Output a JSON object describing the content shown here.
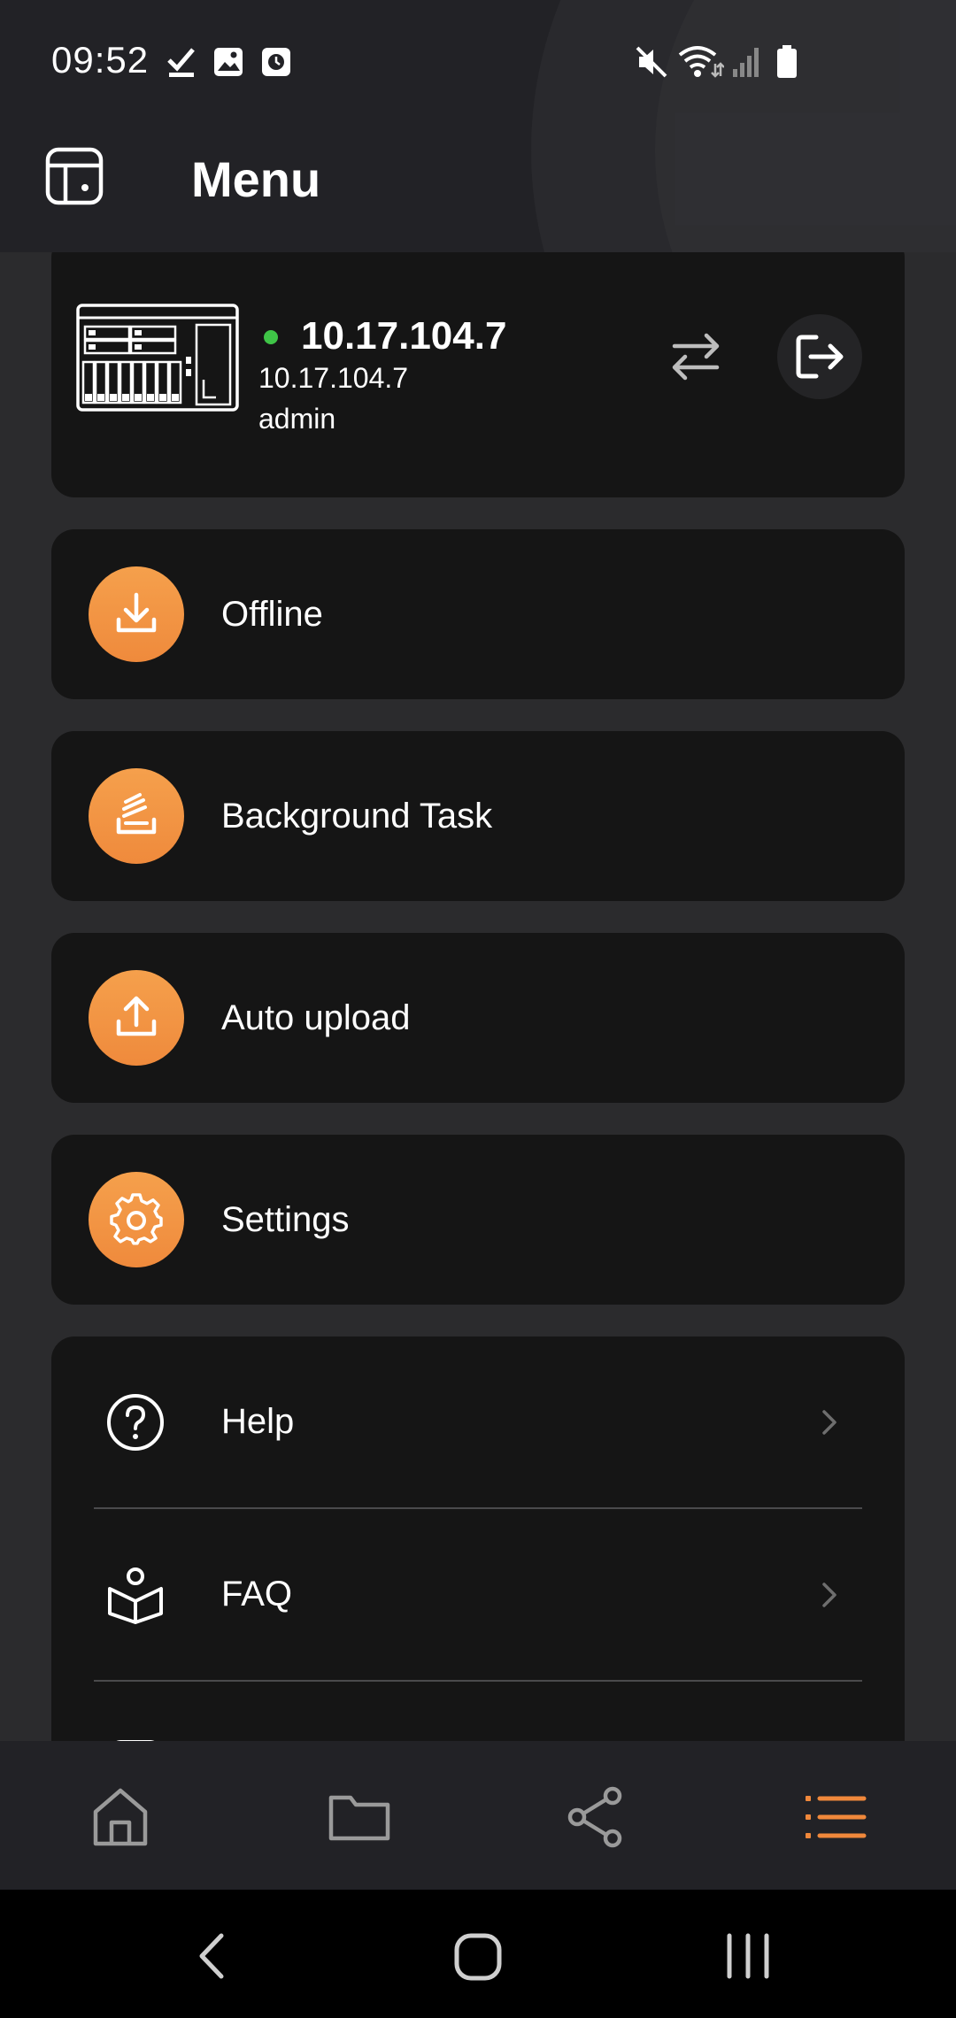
{
  "status_bar": {
    "time": "09:52",
    "left_icons": [
      "check-icon",
      "image-icon",
      "clock-icon"
    ],
    "right_icons": [
      "mute-icon",
      "wifi-icon",
      "signal-icon",
      "battery-icon"
    ]
  },
  "header": {
    "title": "Menu",
    "menu_icon": "sidebar-icon"
  },
  "device": {
    "name": "10.17.104.7",
    "host": "10.17.104.7",
    "user": "admin",
    "status_color": "#3fc447",
    "switch_icon": "switch-arrows-icon",
    "logout_icon": "logout-icon"
  },
  "menu_items": [
    {
      "label": "Offline",
      "icon": "download-icon"
    },
    {
      "label": "Background Task",
      "icon": "tasks-icon"
    },
    {
      "label": "Auto upload",
      "icon": "upload-icon"
    },
    {
      "label": "Settings",
      "icon": "gear-icon"
    }
  ],
  "list_items": [
    {
      "label": "Help",
      "icon": "help-icon"
    },
    {
      "label": "FAQ",
      "icon": "faq-icon"
    }
  ],
  "bottom_nav": {
    "items": [
      "home-icon",
      "folder-icon",
      "share-icon",
      "menu-list-icon"
    ],
    "active": "menu-list-icon",
    "accent": "#f0883b"
  },
  "colors": {
    "accent": "#f0883b",
    "card": "#151515",
    "background": "#2b2b2d"
  }
}
